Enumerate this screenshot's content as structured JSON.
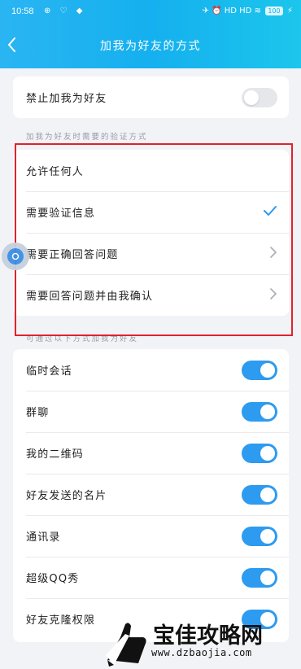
{
  "status_bar": {
    "time": "10:58",
    "left_icons": "⊕ ♡ ◆",
    "right_icons": "✈ ⏰ HD HD ≋",
    "battery": "100"
  },
  "nav": {
    "title": "加我为好友的方式"
  },
  "block_card": {
    "label": "禁止加我为好友",
    "toggle": "off"
  },
  "verify_section": {
    "label": "加我为好友时需要的验证方式",
    "options": [
      {
        "label": "允许任何人",
        "indicator": "none"
      },
      {
        "label": "需要验证信息",
        "indicator": "check"
      },
      {
        "label": "需要正确回答问题",
        "indicator": "chevron"
      },
      {
        "label": "需要回答问题并由我确认",
        "indicator": "chevron"
      }
    ]
  },
  "sources_section": {
    "label": "可通过以下方式加我为好友",
    "items": [
      {
        "label": "临时会话",
        "toggle": "on"
      },
      {
        "label": "群聊",
        "toggle": "on"
      },
      {
        "label": "我的二维码",
        "toggle": "on"
      },
      {
        "label": "好友发送的名片",
        "toggle": "on"
      },
      {
        "label": "通讯录",
        "toggle": "on"
      },
      {
        "label": "超级QQ秀",
        "toggle": "on"
      },
      {
        "label": "好友克隆权限",
        "toggle": "on"
      }
    ]
  },
  "colors": {
    "header": "#15b0ef",
    "toggle_on": "#2d9bf0",
    "check": "#2d9bf0",
    "highlight": "#e0222e"
  },
  "watermark": {
    "title": "宝佳攻略网",
    "url": "www.dzbaojia.com"
  }
}
